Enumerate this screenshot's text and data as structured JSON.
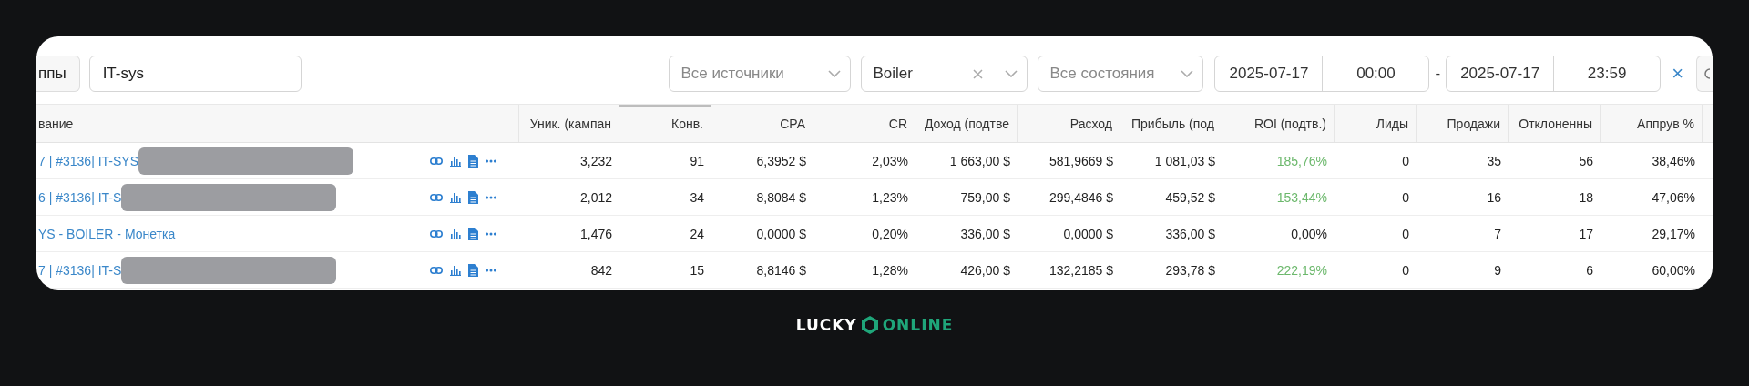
{
  "toolbar": {
    "group_button": "ппы",
    "search": {
      "value": "IT-sys"
    },
    "source_select": {
      "placeholder": "Все источники"
    },
    "offer_select": {
      "value": "Boiler"
    },
    "status_select": {
      "placeholder": "Все состояния"
    },
    "date_from": {
      "date": "2025-07-17",
      "time": "00:00"
    },
    "separator": "-",
    "date_to": {
      "date": "2025-07-17",
      "time": "23:59"
    },
    "clear": "×"
  },
  "table": {
    "columns": [
      {
        "kind": "name",
        "label": "вание",
        "sorted": false
      },
      {
        "kind": "actions",
        "sorted": false
      },
      {
        "kind": "num",
        "label": "Уник. (кампан",
        "sorted": false
      },
      {
        "kind": "num",
        "label": "Конв.",
        "sorted": true
      },
      {
        "kind": "num",
        "label": "CPA",
        "sorted": false
      },
      {
        "kind": "num",
        "label": "CR",
        "sorted": false
      },
      {
        "kind": "num",
        "label": "Доход (подтве",
        "sorted": false
      },
      {
        "kind": "num",
        "label": "Расход",
        "sorted": false
      },
      {
        "kind": "num",
        "label": "Прибыль (под",
        "sorted": false
      },
      {
        "kind": "num",
        "label": "ROI (подтв.)",
        "sorted": false
      },
      {
        "kind": "num",
        "label": "Лиды",
        "sorted": false
      },
      {
        "kind": "num",
        "label": "Продажи",
        "sorted": false
      },
      {
        "kind": "num",
        "label": "Отклоненны",
        "sorted": false
      },
      {
        "kind": "num",
        "label": "Аппрув %",
        "sorted": false
      }
    ],
    "rows": [
      {
        "name": "7 | #3136| IT-SYS",
        "redacted": true,
        "values": [
          "3,232",
          "91",
          "6,3952 $",
          "2,03%",
          "1 663,00 $",
          "581,9669 $",
          "1 081,03 $",
          "185,76%",
          "0",
          "35",
          "56",
          "38,46%"
        ],
        "roi_positive": true
      },
      {
        "name": "6 | #3136| IT-S",
        "redacted": true,
        "values": [
          "2,012",
          "34",
          "8,8084 $",
          "1,23%",
          "759,00 $",
          "299,4846 $",
          "459,52 $",
          "153,44%",
          "0",
          "16",
          "18",
          "47,06%"
        ],
        "roi_positive": true
      },
      {
        "name": "YS - BOILER - Монетка",
        "redacted": false,
        "values": [
          "1,476",
          "24",
          "0,0000 $",
          "0,20%",
          "336,00 $",
          "0,0000 $",
          "336,00 $",
          "0,00%",
          "0",
          "7",
          "17",
          "29,17%"
        ],
        "roi_positive": false
      },
      {
        "name": "7 | #3136| IT-S",
        "redacted": true,
        "values": [
          "842",
          "15",
          "8,8146 $",
          "1,28%",
          "426,00 $",
          "132,2185 $",
          "293,78 $",
          "222,19%",
          "0",
          "9",
          "6",
          "60,00%"
        ],
        "roi_positive": true
      }
    ]
  },
  "logo": {
    "left": "LUCKY",
    "right": "ONLINE"
  }
}
